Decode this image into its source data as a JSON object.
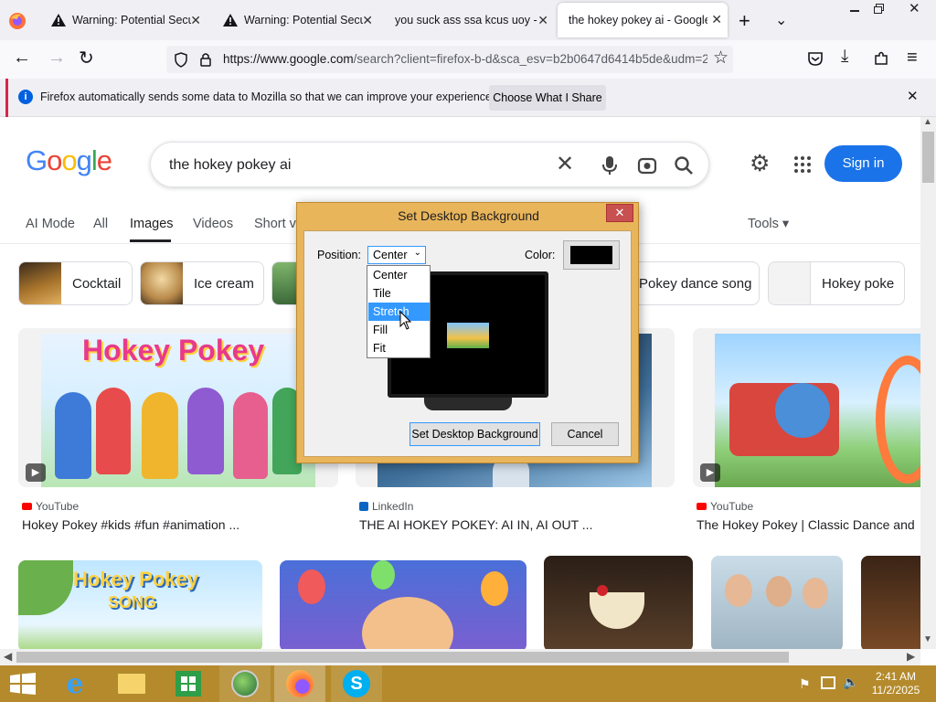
{
  "tabs": [
    {
      "title": "Warning: Potential Security Risk Ahead"
    },
    {
      "title": "Warning: Potential Security Risk Ahead"
    },
    {
      "title": "you suck ass ssa kcus uoy - Google Search"
    },
    {
      "title": "the hokey pokey ai - Google Search"
    }
  ],
  "url": {
    "domain": "https://www.google.com",
    "rest": "/search?client=firefox-b-d&sca_esv=b2b0647d6414b5de&udm=2"
  },
  "notice": {
    "text": "Firefox automatically sends some data to Mozilla so that we can improve your experience.",
    "button": "Choose What I Share"
  },
  "google": {
    "query": "the hokey pokey ai",
    "sign_in": "Sign in",
    "tabs": [
      "AI Mode",
      "All",
      "Images",
      "Videos",
      "Short v"
    ],
    "tools": "Tools",
    "chips": [
      "Cocktail",
      "Ice cream",
      "Pokey dance song",
      "Hokey poke"
    ],
    "results": [
      {
        "source": "YouTube",
        "title": "Hokey Pokey #kids #fun #animation ..."
      },
      {
        "source": "LinkedIn",
        "title": "THE AI HOKEY POKEY: AI IN, AI OUT ..."
      },
      {
        "source": "YouTube",
        "title": "The Hokey Pokey | Classic Dance and"
      }
    ],
    "thumb_text": {
      "title1": "Hokey Pokey",
      "title2a": "Hokey Pokey",
      "title2b": "SONG"
    }
  },
  "dialog": {
    "title": "Set Desktop Background",
    "position_label": "Position:",
    "position_value": "Center",
    "color_label": "Color:",
    "color_value": "#000000",
    "options": [
      "Center",
      "Tile",
      "Stretch",
      "Fill",
      "Fit"
    ],
    "highlighted": "Stretch",
    "ok": "Set Desktop Background",
    "cancel": "Cancel"
  },
  "taskbar": {
    "time": "2:41 AM",
    "date": "11/2/2025"
  },
  "colors": {
    "accent": "#1a73e8",
    "dialog_frame": "#e9b55b",
    "taskbar": "#b48a2c",
    "dropdown_highlight": "#3399ff"
  }
}
